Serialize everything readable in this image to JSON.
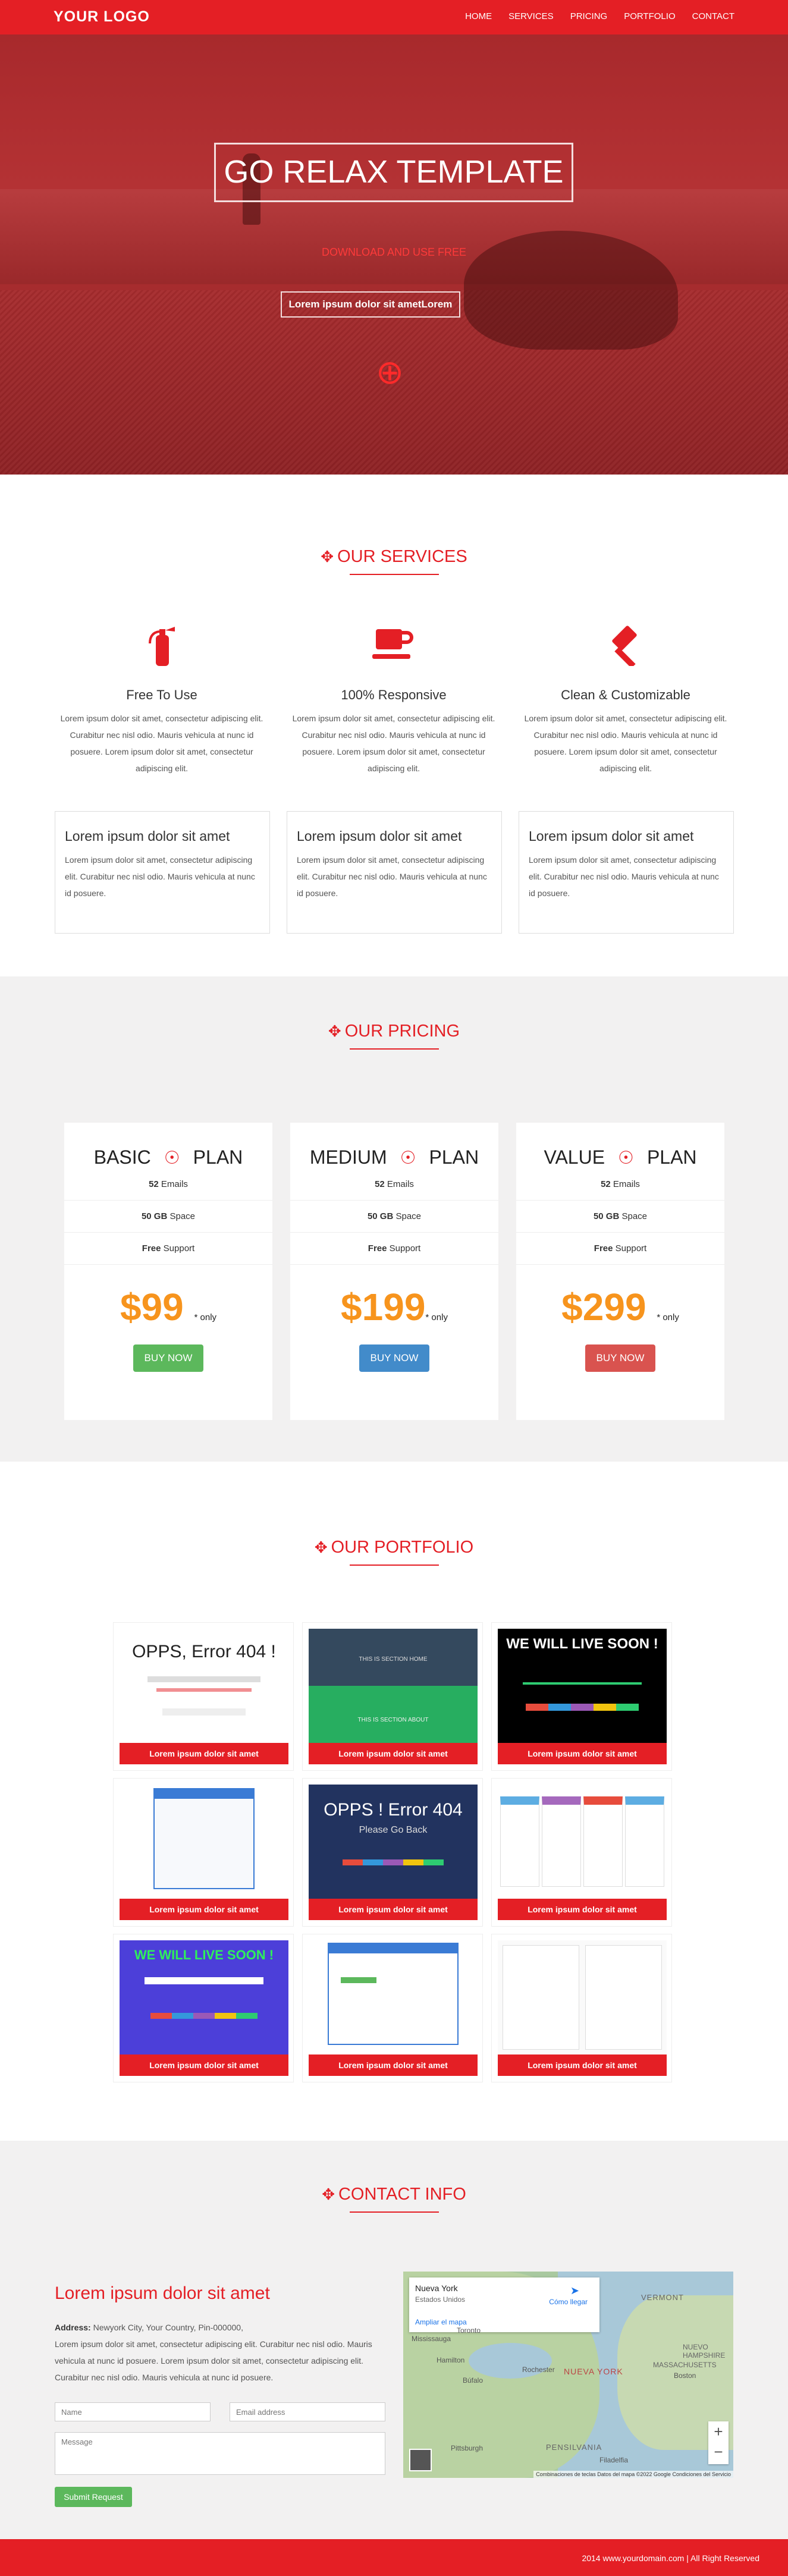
{
  "nav": {
    "logo": "YOUR LOGO",
    "items": [
      "HOME",
      "SERVICES",
      "PRICING",
      "PORTFOLIO",
      "CONTACT"
    ]
  },
  "hero": {
    "title": "GO RELAX TEMPLATE",
    "subtitle": "DOWNLOAD AND USE FREE",
    "button": "Lorem ipsum dolor sit ametLorem",
    "icon": "crosshair-icon"
  },
  "services": {
    "heading": "OUR SERVICES",
    "items": [
      {
        "icon": "fire-extinguisher-icon",
        "title": "Free To Use",
        "text": "Lorem ipsum dolor sit amet, consectetur adipiscing elit. Curabitur nec nisl odio. Mauris vehicula at nunc id posuere. Lorem ipsum dolor sit amet, consectetur adipiscing elit."
      },
      {
        "icon": "coffee-cup-icon",
        "title": "100% Responsive",
        "text": "Lorem ipsum dolor sit amet, consectetur adipiscing elit. Curabitur nec nisl odio. Mauris vehicula at nunc id posuere. Lorem ipsum dolor sit amet, consectetur adipiscing elit."
      },
      {
        "icon": "gavel-icon",
        "title": "Clean & Customizable",
        "text": "Lorem ipsum dolor sit amet, consectetur adipiscing elit. Curabitur nec nisl odio. Mauris vehicula at nunc id posuere. Lorem ipsum dolor sit amet, consectetur adipiscing elit."
      }
    ],
    "boxes": [
      {
        "title": "Lorem ipsum dolor sit amet",
        "text": "Lorem ipsum dolor sit amet, consectetur adipiscing elit. Curabitur nec nisl odio. Mauris vehicula at nunc id posuere."
      },
      {
        "title": "Lorem ipsum dolor sit amet",
        "text": "Lorem ipsum dolor sit amet, consectetur adipiscing elit. Curabitur nec nisl odio. Mauris vehicula at nunc id posuere."
      },
      {
        "title": "Lorem ipsum dolor sit amet",
        "text": "Lorem ipsum dolor sit amet, consectetur adipiscing elit. Curabitur nec nisl odio. Mauris vehicula at nunc id posuere."
      }
    ]
  },
  "pricing": {
    "heading": "OUR PRICING",
    "plans": [
      {
        "name": "BASIC",
        "suffix": "PLAN",
        "f1n": "52",
        "f1": "Emails",
        "f2n": "50 GB",
        "f2": "Space",
        "f3n": "Free",
        "f3": "Support",
        "price": "$99",
        "only": "* only",
        "button": "BUY NOW",
        "color": "#5cb85c"
      },
      {
        "name": "MEDIUM",
        "suffix": "PLAN",
        "f1n": "52",
        "f1": "Emails",
        "f2n": "50 GB",
        "f2": "Space",
        "f3n": "Free",
        "f3": "Support",
        "price": "$199",
        "only": "* only",
        "button": "BUY NOW",
        "color": "#428bca"
      },
      {
        "name": "VALUE",
        "suffix": "PLAN",
        "f1n": "52",
        "f1": "Emails",
        "f2n": "50 GB",
        "f2": "Space",
        "f3n": "Free",
        "f3": "Support",
        "price": "$299",
        "only": "* only",
        "button": "BUY NOW",
        "color": "#d9534f"
      }
    ]
  },
  "portfolio": {
    "heading": "OUR PORTFOLIO",
    "caption": "Lorem ipsum dolor sit amet",
    "thumbs": {
      "error404": "OPPS, Error 404 !",
      "livesoon": "WE WILL LIVE SOON !",
      "oppsError": "OPPS ! Error 404",
      "goBack": "Please Go Back",
      "sectionHome": "THIS IS SECTION HOME",
      "sectionAbout": "THIS IS SECTION ABOUT"
    }
  },
  "contact": {
    "heading": "CONTACT INFO",
    "title": "Lorem ipsum dolor sit amet",
    "address_label": "Address:",
    "address": "Newyork City, Your Country, Pin-000000,",
    "text": "Lorem ipsum dolor sit amet, consectetur adipiscing elit. Curabitur nec nisl odio. Mauris vehicula at nunc id posuere. Lorem ipsum dolor sit amet, consectetur adipiscing elit. Curabitur nec nisl odio. Mauris vehicula at nunc id posuere.",
    "name_ph": "Name",
    "email_ph": "Email address",
    "message_ph": "Message",
    "submit": "Submit Request"
  },
  "map": {
    "place": "Nueva York",
    "region": "Estados Unidos",
    "directions": "Cómo llegar",
    "enlarge": "Ampliar el mapa",
    "labels": [
      "Toronto",
      "Mississauga",
      "Hamilton",
      "Búfalo",
      "NUEVA YORK",
      "PENSILVANIA",
      "Pittsburgh",
      "Filadelfia",
      "VERMONT",
      "NUEVO HAMPSHIRE",
      "MASSACHUSETTS",
      "Boston",
      "Rochester"
    ],
    "attribution": "Combinaciones de teclas   Datos del mapa ©2022 Google   Condiciones del Servicio"
  },
  "footer": {
    "text": "2014 www.yourdomain.com | All Right Reserved"
  }
}
